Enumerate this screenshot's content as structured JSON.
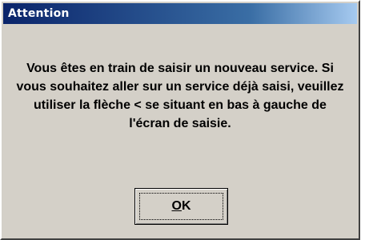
{
  "window": {
    "title": "Attention"
  },
  "dialog": {
    "message_lines": [
      "Vous êtes en train de saisir un nouveau service. Si",
      "vous souhaitez aller sur un service déjà saisi, veuillez",
      "utiliser la flèche < se situant en bas à gauche de",
      "l'écran de saisie."
    ],
    "ok_button": {
      "mnemonic": "O",
      "rest": "K"
    }
  },
  "colors": {
    "dialog_background": "#d4d0c8",
    "titlebar_start": "#0a246a",
    "titlebar_end": "#a6caf0",
    "title_text": "#ffffff"
  }
}
